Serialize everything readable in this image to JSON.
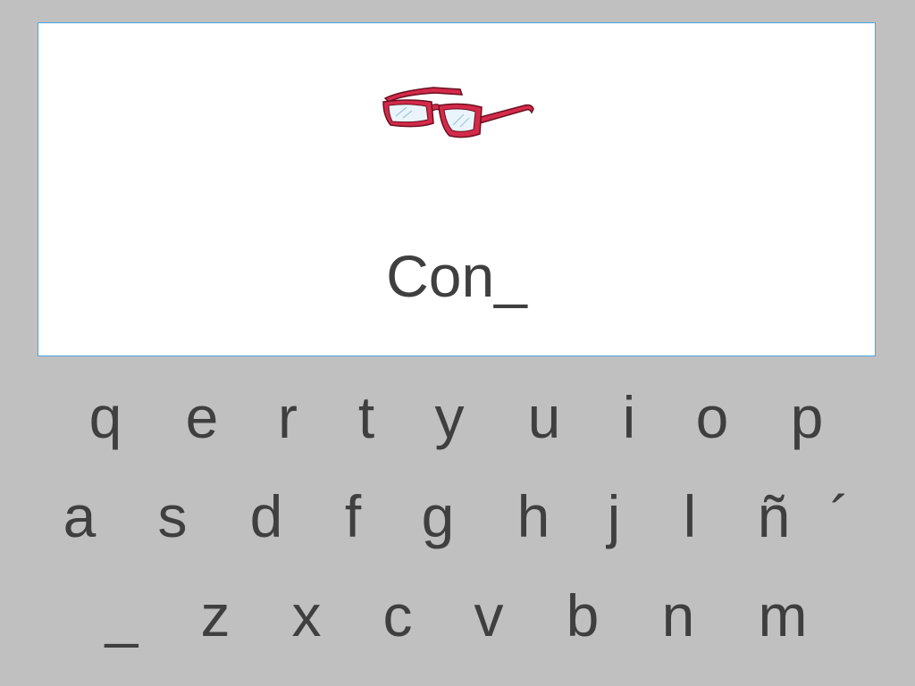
{
  "exercise": {
    "word": "Con_",
    "image_icon": "glasses-icon"
  },
  "keyboard": {
    "rows": [
      [
        "q",
        "e",
        "r",
        "t",
        "y",
        "u",
        "i",
        "o",
        "p"
      ],
      [
        "a",
        "s",
        "d",
        "f",
        "g",
        "h",
        "j",
        "l",
        "ñ",
        "´"
      ],
      [
        "_",
        "z",
        "x",
        "c",
        "v",
        "b",
        "n",
        "m"
      ]
    ]
  },
  "colors": {
    "background": "#c0c0c0",
    "card": "#ffffff",
    "card_border": "#4aa3df",
    "text": "#3f3f3f",
    "glasses_frame": "#d42a4a"
  }
}
